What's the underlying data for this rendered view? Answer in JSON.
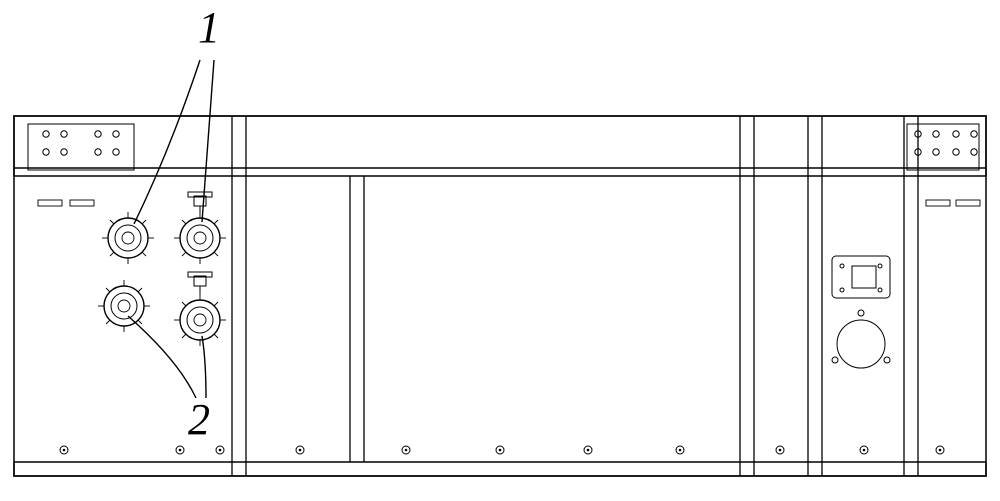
{
  "figure": {
    "labels": {
      "one": "1",
      "two": "2"
    },
    "callouts": [
      {
        "id": "1",
        "part": "valve-assembly-upper",
        "description": "upper right connector with valve handle"
      },
      {
        "id": "2",
        "part": "connector-lower-right",
        "description": "lower right threaded port"
      }
    ],
    "panel": {
      "type": "rear-panel-enclosure",
      "sections": [
        "left-port-panel",
        "center-blank-panel",
        "right-service-panel"
      ],
      "ports": {
        "upper_left": "threaded-port",
        "upper_right": "valved-port",
        "lower_left": "threaded-port",
        "lower_right": "threaded-port"
      },
      "right_service": {
        "knockout": "circular-knockout",
        "cover": "small-rect-cover"
      },
      "fasteners": {
        "top_rail_bolt_groups": 2,
        "bottom_lip_screws": 11,
        "vertical_stiffeners": 4
      }
    }
  }
}
